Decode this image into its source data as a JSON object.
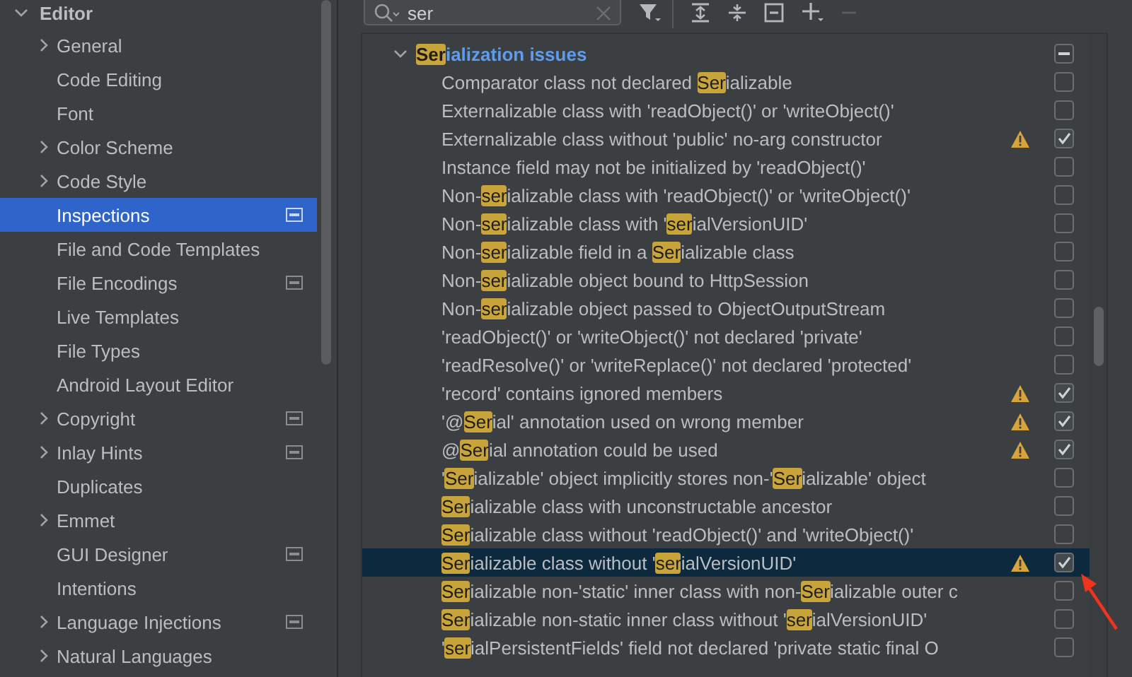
{
  "sidebar": {
    "label": "Editor",
    "expanded": true,
    "children": [
      {
        "label": "General",
        "kind": "group",
        "selected": false,
        "scheme_icon": false
      },
      {
        "label": "Code Editing",
        "kind": "leaf",
        "selected": false,
        "scheme_icon": false
      },
      {
        "label": "Font",
        "kind": "leaf",
        "selected": false,
        "scheme_icon": false
      },
      {
        "label": "Color Scheme",
        "kind": "group",
        "selected": false,
        "scheme_icon": false
      },
      {
        "label": "Code Style",
        "kind": "group",
        "selected": false,
        "scheme_icon": false
      },
      {
        "label": "Inspections",
        "kind": "leaf",
        "selected": true,
        "scheme_icon": true
      },
      {
        "label": "File and Code Templates",
        "kind": "leaf",
        "selected": false,
        "scheme_icon": false
      },
      {
        "label": "File Encodings",
        "kind": "leaf",
        "selected": false,
        "scheme_icon": true
      },
      {
        "label": "Live Templates",
        "kind": "leaf",
        "selected": false,
        "scheme_icon": false
      },
      {
        "label": "File Types",
        "kind": "leaf",
        "selected": false,
        "scheme_icon": false
      },
      {
        "label": "Android Layout Editor",
        "kind": "leaf",
        "selected": false,
        "scheme_icon": false
      },
      {
        "label": "Copyright",
        "kind": "group",
        "selected": false,
        "scheme_icon": true
      },
      {
        "label": "Inlay Hints",
        "kind": "group",
        "selected": false,
        "scheme_icon": true
      },
      {
        "label": "Duplicates",
        "kind": "leaf",
        "selected": false,
        "scheme_icon": false
      },
      {
        "label": "Emmet",
        "kind": "group",
        "selected": false,
        "scheme_icon": false
      },
      {
        "label": "GUI Designer",
        "kind": "leaf",
        "selected": false,
        "scheme_icon": true
      },
      {
        "label": "Intentions",
        "kind": "leaf",
        "selected": false,
        "scheme_icon": false
      },
      {
        "label": "Language Injections",
        "kind": "group",
        "selected": false,
        "scheme_icon": true
      },
      {
        "label": "Natural Languages",
        "kind": "group",
        "selected": false,
        "scheme_icon": false
      }
    ]
  },
  "search": {
    "value": "ser"
  },
  "toolbar": [
    {
      "kind": "filter",
      "disabled": false
    },
    {
      "kind": "expand_all",
      "disabled": false
    },
    {
      "kind": "collapse_all",
      "disabled": false
    },
    {
      "kind": "reset",
      "disabled": false
    },
    {
      "kind": "add",
      "disabled": false
    },
    {
      "kind": "remove",
      "disabled": true
    }
  ],
  "inspections": {
    "label": [
      {
        "text": "Ser",
        "match": true
      },
      {
        "text": "ialization issues",
        "match": false
      }
    ],
    "expanded": true,
    "partial": true,
    "children": [
      {
        "label": [
          {
            "text": "Comparator class not declared ",
            "match": false
          },
          {
            "text": "Ser",
            "match": true
          },
          {
            "text": "ializable",
            "match": false
          }
        ],
        "warning": false,
        "checked": false,
        "selected": false
      },
      {
        "label": [
          {
            "text": "Externalizable class with 'readObject()' or 'writeObject()'",
            "match": false
          }
        ],
        "warning": false,
        "checked": false,
        "selected": false
      },
      {
        "label": [
          {
            "text": "Externalizable class without 'public' no-arg constructor",
            "match": false
          }
        ],
        "warning": true,
        "checked": true,
        "selected": false
      },
      {
        "label": [
          {
            "text": "Instance field may not be initialized by 'readObject()'",
            "match": false
          }
        ],
        "warning": false,
        "checked": false,
        "selected": false
      },
      {
        "label": [
          {
            "text": "Non-",
            "match": false
          },
          {
            "text": "ser",
            "match": true
          },
          {
            "text": "ializable class with 'readObject()' or 'writeObject()'",
            "match": false
          }
        ],
        "warning": false,
        "checked": false,
        "selected": false
      },
      {
        "label": [
          {
            "text": "Non-",
            "match": false
          },
          {
            "text": "ser",
            "match": true
          },
          {
            "text": "ializable class with '",
            "match": false
          },
          {
            "text": "ser",
            "match": true
          },
          {
            "text": "ialVersionUID'",
            "match": false
          }
        ],
        "warning": false,
        "checked": false,
        "selected": false
      },
      {
        "label": [
          {
            "text": "Non-",
            "match": false
          },
          {
            "text": "ser",
            "match": true
          },
          {
            "text": "ializable field in a ",
            "match": false
          },
          {
            "text": "Ser",
            "match": true
          },
          {
            "text": "ializable class",
            "match": false
          }
        ],
        "warning": false,
        "checked": false,
        "selected": false
      },
      {
        "label": [
          {
            "text": "Non-",
            "match": false
          },
          {
            "text": "ser",
            "match": true
          },
          {
            "text": "ializable object bound to HttpSession",
            "match": false
          }
        ],
        "warning": false,
        "checked": false,
        "selected": false
      },
      {
        "label": [
          {
            "text": "Non-",
            "match": false
          },
          {
            "text": "ser",
            "match": true
          },
          {
            "text": "ializable object passed to ObjectOutputStream",
            "match": false
          }
        ],
        "warning": false,
        "checked": false,
        "selected": false
      },
      {
        "label": [
          {
            "text": "'readObject()' or 'writeObject()' not declared 'private'",
            "match": false
          }
        ],
        "warning": false,
        "checked": false,
        "selected": false
      },
      {
        "label": [
          {
            "text": "'readResolve()' or 'writeReplace()' not declared 'protected'",
            "match": false
          }
        ],
        "warning": false,
        "checked": false,
        "selected": false
      },
      {
        "label": [
          {
            "text": "'record' contains ignored members",
            "match": false
          }
        ],
        "warning": true,
        "checked": true,
        "selected": false
      },
      {
        "label": [
          {
            "text": "'@",
            "match": false
          },
          {
            "text": "Ser",
            "match": true
          },
          {
            "text": "ial' annotation used on wrong member",
            "match": false
          }
        ],
        "warning": true,
        "checked": true,
        "selected": false
      },
      {
        "label": [
          {
            "text": "@",
            "match": false
          },
          {
            "text": "Ser",
            "match": true
          },
          {
            "text": "ial annotation could be used",
            "match": false
          }
        ],
        "warning": true,
        "checked": true,
        "selected": false
      },
      {
        "label": [
          {
            "text": "'",
            "match": false
          },
          {
            "text": "Ser",
            "match": true
          },
          {
            "text": "ializable' object implicitly stores non-'",
            "match": false
          },
          {
            "text": "Ser",
            "match": true
          },
          {
            "text": "ializable' object",
            "match": false
          }
        ],
        "warning": false,
        "checked": false,
        "selected": false
      },
      {
        "label": [
          {
            "text": "Ser",
            "match": true
          },
          {
            "text": "ializable class with unconstructable ancestor",
            "match": false
          }
        ],
        "warning": false,
        "checked": false,
        "selected": false
      },
      {
        "label": [
          {
            "text": "Ser",
            "match": true
          },
          {
            "text": "ializable class without 'readObject()' and 'writeObject()'",
            "match": false
          }
        ],
        "warning": false,
        "checked": false,
        "selected": false
      },
      {
        "label": [
          {
            "text": "Ser",
            "match": true
          },
          {
            "text": "ializable class without '",
            "match": false
          },
          {
            "text": "ser",
            "match": true
          },
          {
            "text": "ialVersionUID'",
            "match": false
          }
        ],
        "warning": true,
        "checked": true,
        "selected": true
      },
      {
        "label": [
          {
            "text": "Ser",
            "match": true
          },
          {
            "text": "ializable non-'static' inner class with non-",
            "match": false
          },
          {
            "text": "Ser",
            "match": true
          },
          {
            "text": "ializable outer c",
            "match": false
          }
        ],
        "warning": false,
        "checked": false,
        "selected": false
      },
      {
        "label": [
          {
            "text": "Ser",
            "match": true
          },
          {
            "text": "ializable non-static inner class without '",
            "match": false
          },
          {
            "text": "ser",
            "match": true
          },
          {
            "text": "ialVersionUID'",
            "match": false
          }
        ],
        "warning": false,
        "checked": false,
        "selected": false
      },
      {
        "label": [
          {
            "text": "'",
            "match": false
          },
          {
            "text": "ser",
            "match": true
          },
          {
            "text": "ialPersistentFields' field not declared 'private static final O",
            "match": false
          }
        ],
        "warning": false,
        "checked": false,
        "selected": false
      }
    ]
  },
  "annotation": {
    "kind": "arrow"
  }
}
